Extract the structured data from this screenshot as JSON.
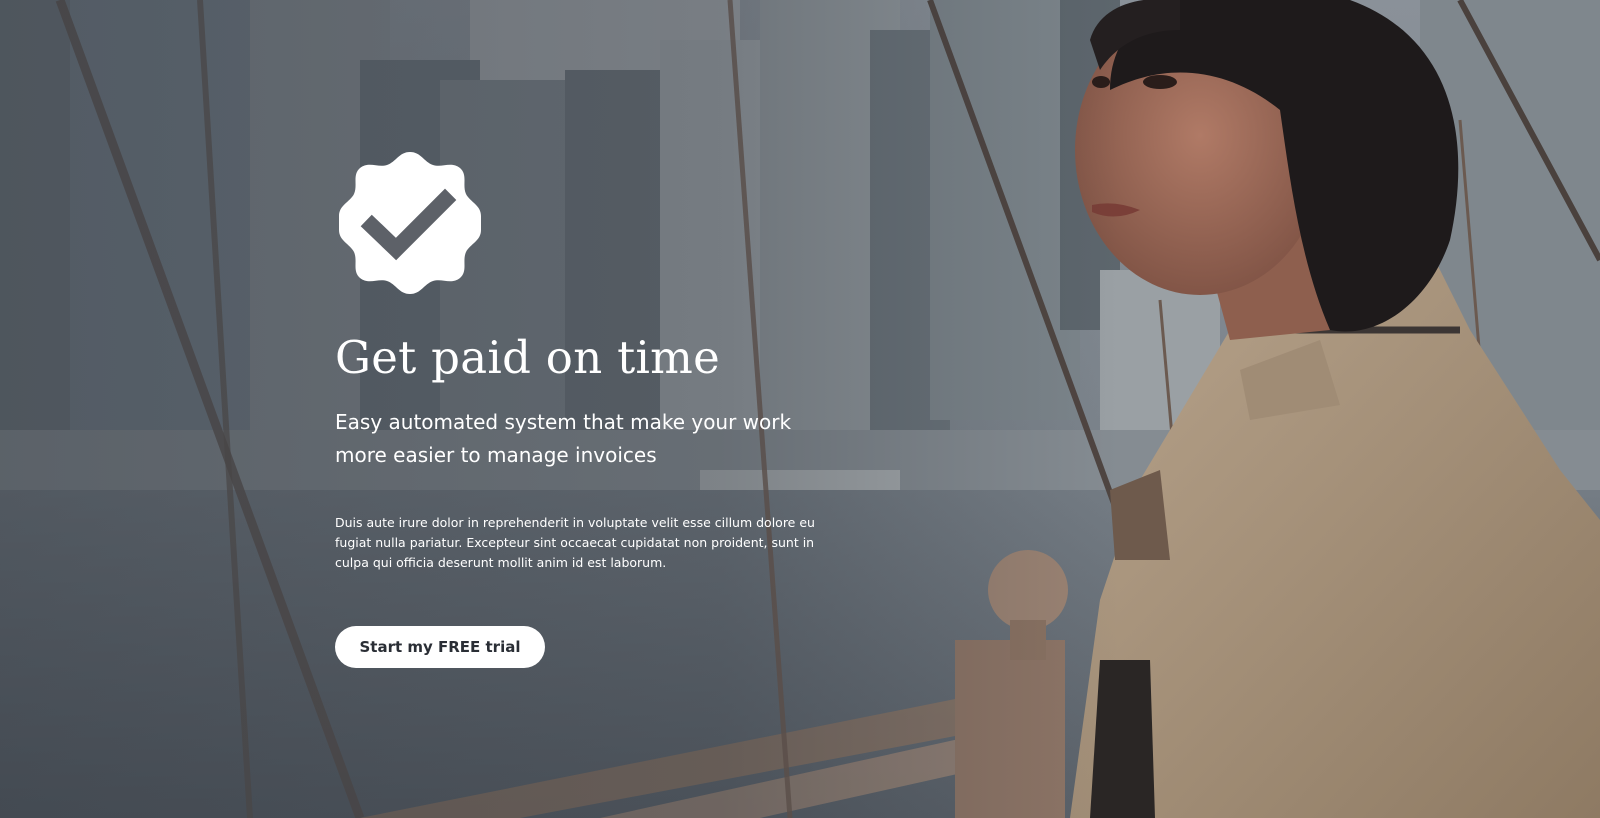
{
  "hero": {
    "badge_icon": "verified-check-badge-icon",
    "title": "Get paid on time",
    "subtitle": "Easy automated system that make your work more easier to manage invoices",
    "body": "Duis aute irure dolor in reprehenderit in voluptate velit esse cillum dolore eu fugiat nulla pariatur. Excepteur sint occaecat cupidatat non proident, sunt in culpa qui officia deserunt mollit anim id est laborum.",
    "cta_label": "Start my FREE trial"
  },
  "colors": {
    "text": "#ffffff",
    "button_bg": "#ffffff",
    "button_text": "#2a2e35",
    "overlay": "#5c656d"
  }
}
